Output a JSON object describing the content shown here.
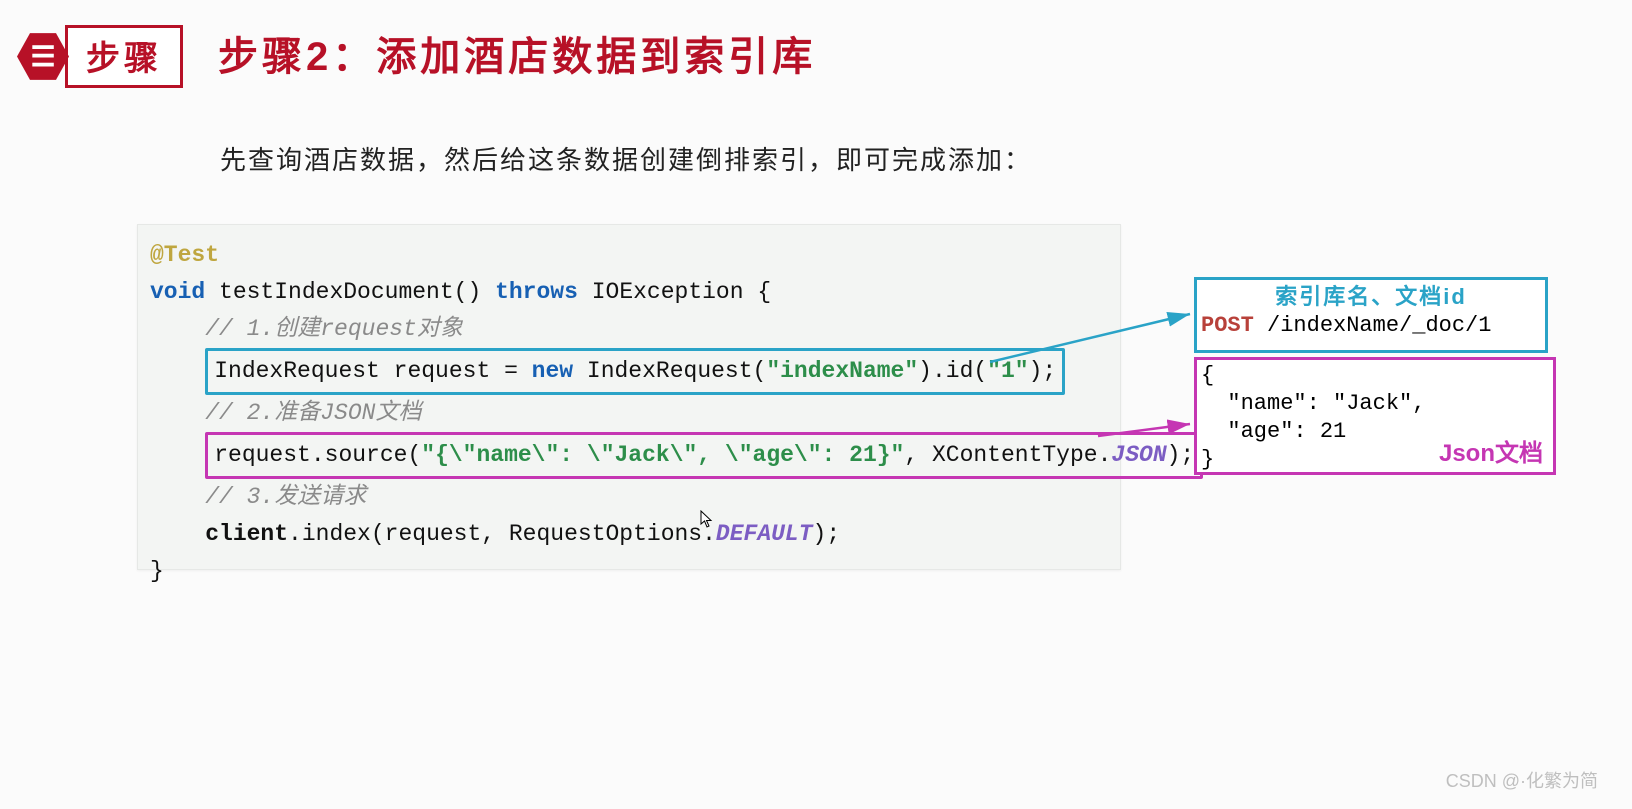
{
  "header": {
    "badge_icon_glyph": "☰",
    "step_label": "步骤",
    "title": "步骤2：添加酒店数据到索引库"
  },
  "subtitle": "先查询酒店数据，然后给这条数据创建倒排索引，即可完成添加：",
  "code": {
    "annotation": "@Test",
    "kw_void": "void",
    "fn_sig": " testIndexDocument() ",
    "kw_throws": "throws",
    "throws_type": " IOException {",
    "cm1": "// 1.创建request对象",
    "l1_a": "IndexRequest request = ",
    "l1_new": "new",
    "l1_b": " IndexRequest(",
    "l1_str1": "\"indexName\"",
    "l1_c": ").id(",
    "l1_str2": "\"1\"",
    "l1_d": ");",
    "cm2": "// 2.准备JSON文档",
    "l2_a": "request.source(",
    "l2_str": "\"{\\\"name\\\": \\\"Jack\\\", \\\"age\\\": 21}\"",
    "l2_b": ", XContentType.",
    "l2_json": "JSON",
    "l2_c": ");",
    "cm3": "// 3.发送请求",
    "l3_a": "client",
    "l3_b": ".index(request, RequestOptions.",
    "l3_default": "DEFAULT",
    "l3_c": ");",
    "close": "}"
  },
  "callout1": {
    "label": "索引库名、文档id",
    "method": "POST",
    "path": " /indexName/_doc/1"
  },
  "callout2": {
    "line1": "{",
    "line2": "  \"name\": \"Jack\",",
    "line3": "  \"age\": 21",
    "line4": "}",
    "label": "Json文档"
  },
  "watermark": "CSDN @·化繁为简"
}
